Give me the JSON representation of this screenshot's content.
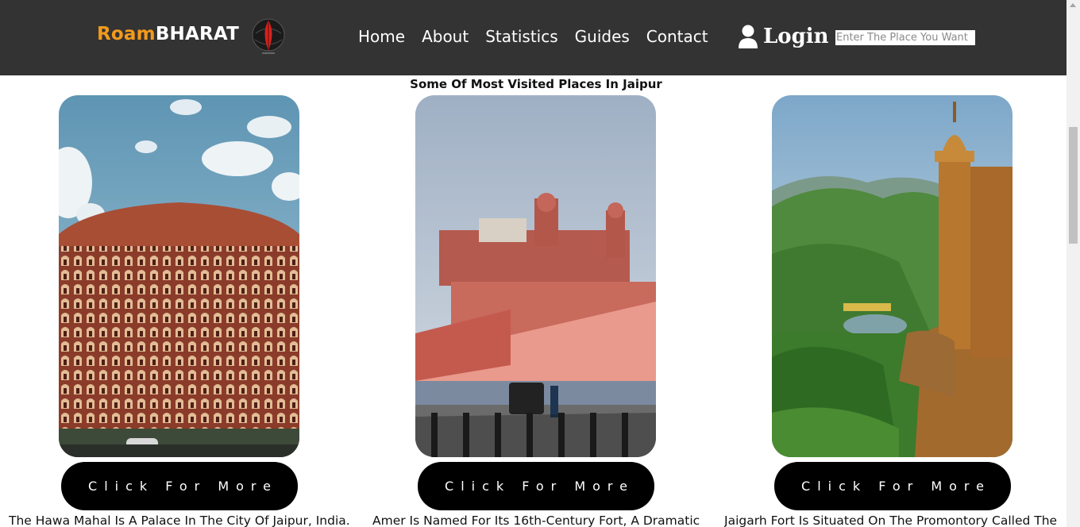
{
  "brand": {
    "name_part1": "Roam",
    "name_part2": "BHARAT",
    "logo_icon": "red-leaf-globe-icon"
  },
  "nav": {
    "items": [
      "Home",
      "About",
      "Statistics",
      "Guides",
      "Contact"
    ]
  },
  "login": {
    "label": "Login",
    "icon": "user-icon"
  },
  "search": {
    "placeholder": "Enter The Place You Want",
    "value": ""
  },
  "section": {
    "title": "Some Of Most Visited Places In Jaipur"
  },
  "cards": [
    {
      "image": "hawa-mahal-photo",
      "button_label": "Click For More",
      "description": "The Hawa Mahal Is A Palace In The City Of Jaipur, India."
    },
    {
      "image": "amer-fort-photo",
      "button_label": "Click For More",
      "description": "Amer Is Named For Its 16th-Century Fort, A Dramatic"
    },
    {
      "image": "jaigarh-fort-photo",
      "button_label": "Click For More",
      "description": "Jaigarh Fort Is Situated On The Promontory Called The"
    }
  ],
  "colors": {
    "header_bg": "#333333",
    "brand_accent": "#f39a1c",
    "button_bg": "#000000"
  }
}
